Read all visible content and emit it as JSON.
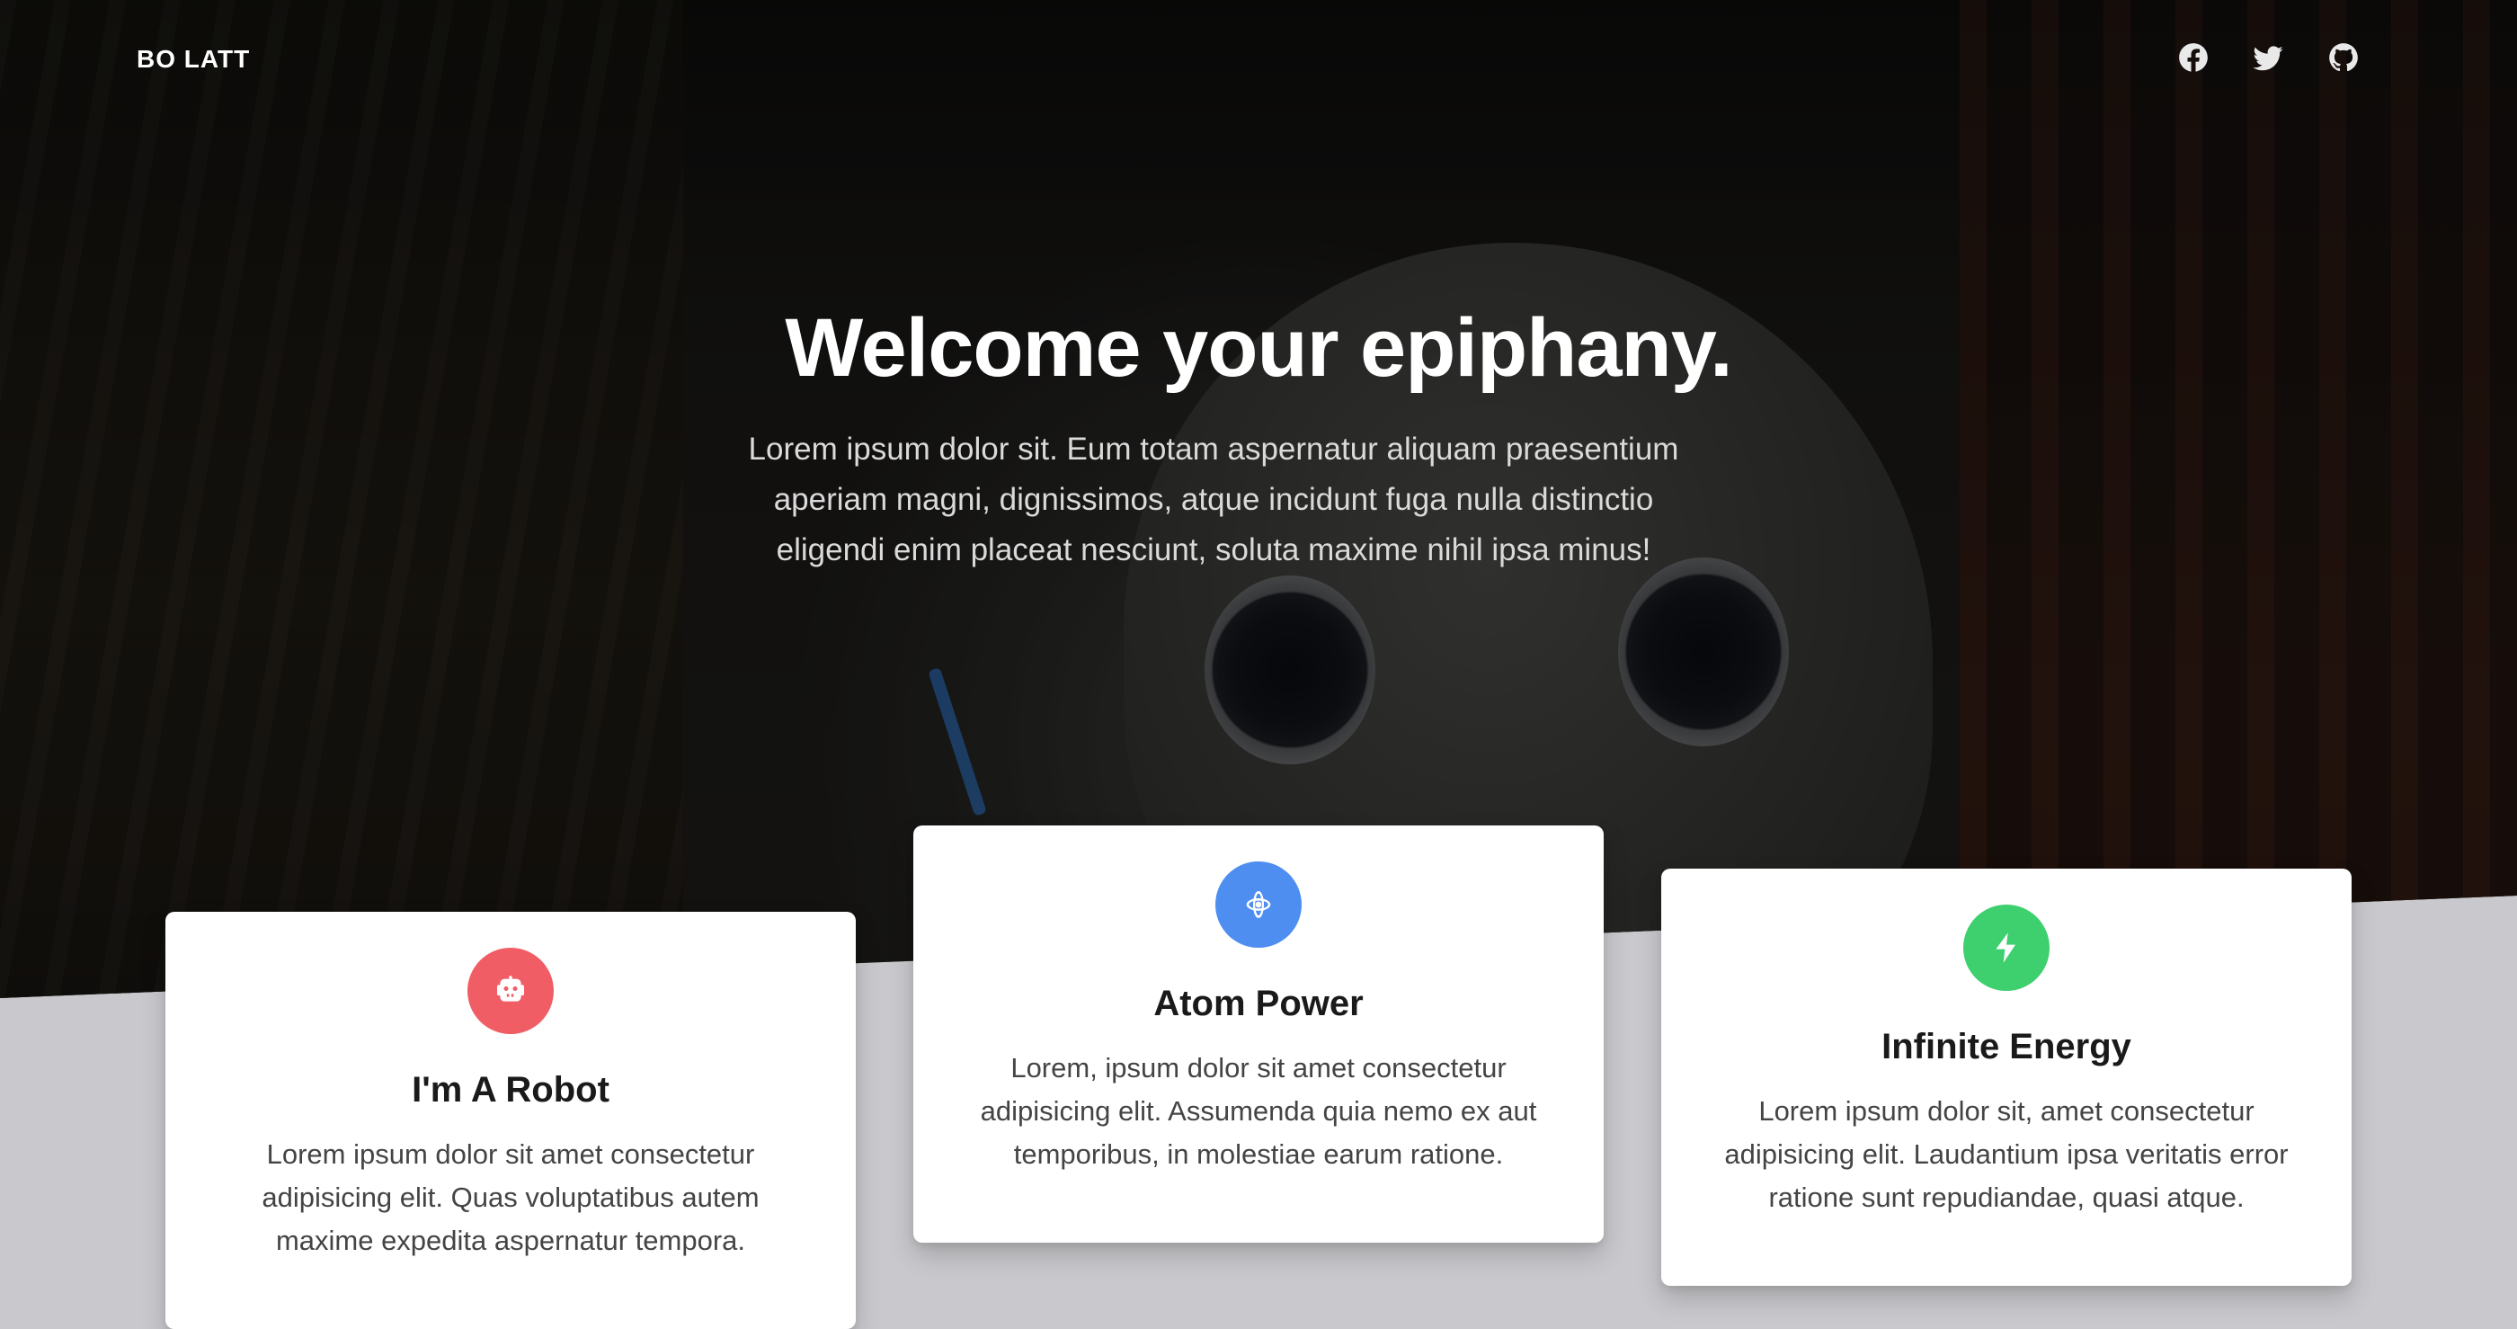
{
  "brand": {
    "name": "BO LATT"
  },
  "social": [
    {
      "name": "Facebook",
      "icon": "facebook-icon"
    },
    {
      "name": "Twitter",
      "icon": "twitter-icon"
    },
    {
      "name": "GitHub",
      "icon": "github-icon"
    }
  ],
  "hero": {
    "title": "Welcome your epiphany.",
    "subtitle": "Lorem ipsum dolor sit. Eum totam aspernatur aliquam praesentium aperiam magni, dignissimos, atque incidunt fuga nulla distinctio eligendi enim placeat nesciunt, soluta maxime nihil ipsa minus!"
  },
  "features": [
    {
      "title": "I'm A Robot",
      "text": "Lorem ipsum dolor sit amet consectetur adipisicing elit. Quas voluptatibus autem maxime expedita aspernatur tempora.",
      "icon": "robot-icon",
      "color": "#f05d65"
    },
    {
      "title": "Atom Power",
      "text": "Lorem, ipsum dolor sit amet consectetur adipisicing elit. Assumenda quia nemo ex aut temporibus, in molestiae earum ratione.",
      "icon": "atom-icon",
      "color": "#4e8ef0"
    },
    {
      "title": "Infinite Energy",
      "text": "Lorem ipsum dolor sit, amet consectetur adipisicing elit. Laudantium ipsa veritatis error ratione sunt repudiandae, quasi atque.",
      "icon": "bolt-icon",
      "color": "#3ed06e"
    }
  ]
}
